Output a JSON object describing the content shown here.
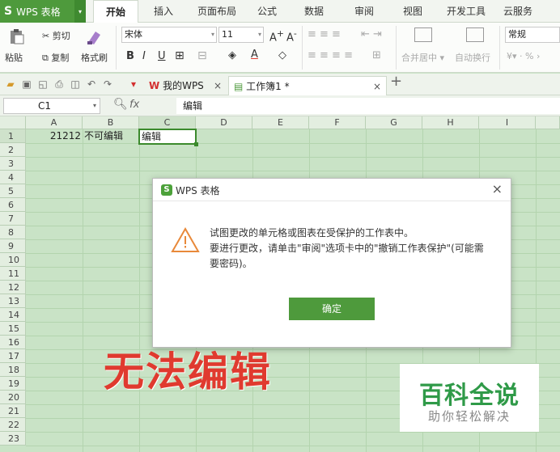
{
  "app": {
    "logo": "S",
    "title": "WPS 表格",
    "dropdown_arrow": "▾"
  },
  "menu_tabs": [
    "开始",
    "插入",
    "页面布局",
    "公式",
    "数据",
    "审阅",
    "视图",
    "开发工具",
    "云服务"
  ],
  "ribbon": {
    "cut": "剪切",
    "paste": "粘贴",
    "copy": "复制",
    "format_painter": "格式刷",
    "font_name": "宋体",
    "font_size": "11",
    "merge_center": "合并居中",
    "wrap_text": "自动换行",
    "number_format": "常规",
    "percent": "%"
  },
  "doc_tabs": [
    {
      "label": "我的WPS",
      "active": false
    },
    {
      "label": "工作簿1 *",
      "active": true
    }
  ],
  "formula_bar": {
    "cell_ref": "C1",
    "fx": "fx",
    "value": "编辑"
  },
  "columns": [
    "A",
    "B",
    "C",
    "D",
    "E",
    "F",
    "G",
    "H",
    "I"
  ],
  "rows": [
    "1",
    "2",
    "3",
    "4",
    "5",
    "6",
    "7",
    "8",
    "9",
    "10",
    "11",
    "12",
    "13",
    "14",
    "15",
    "16",
    "17",
    "18",
    "19",
    "20",
    "21",
    "22",
    "23"
  ],
  "cells": {
    "a1": "21212",
    "b1": "不可编辑",
    "c1": "编辑"
  },
  "dialog": {
    "title": "WPS 表格",
    "message_line1": "试图更改的单元格或图表在受保护的工作表中。",
    "message_line2": "要进行更改，请单击\"审阅\"选项卡中的\"撤销工作表保护\"(可能需要密码)。",
    "ok": "确定"
  },
  "annotation": {
    "text": "无法编辑",
    "color": "#e03a2f"
  },
  "watermark": {
    "title": "百科全说",
    "subtitle": "助你轻松解决"
  },
  "colors": {
    "accent": "#4e9a3c",
    "grid_bg": "#c9e3c6"
  }
}
